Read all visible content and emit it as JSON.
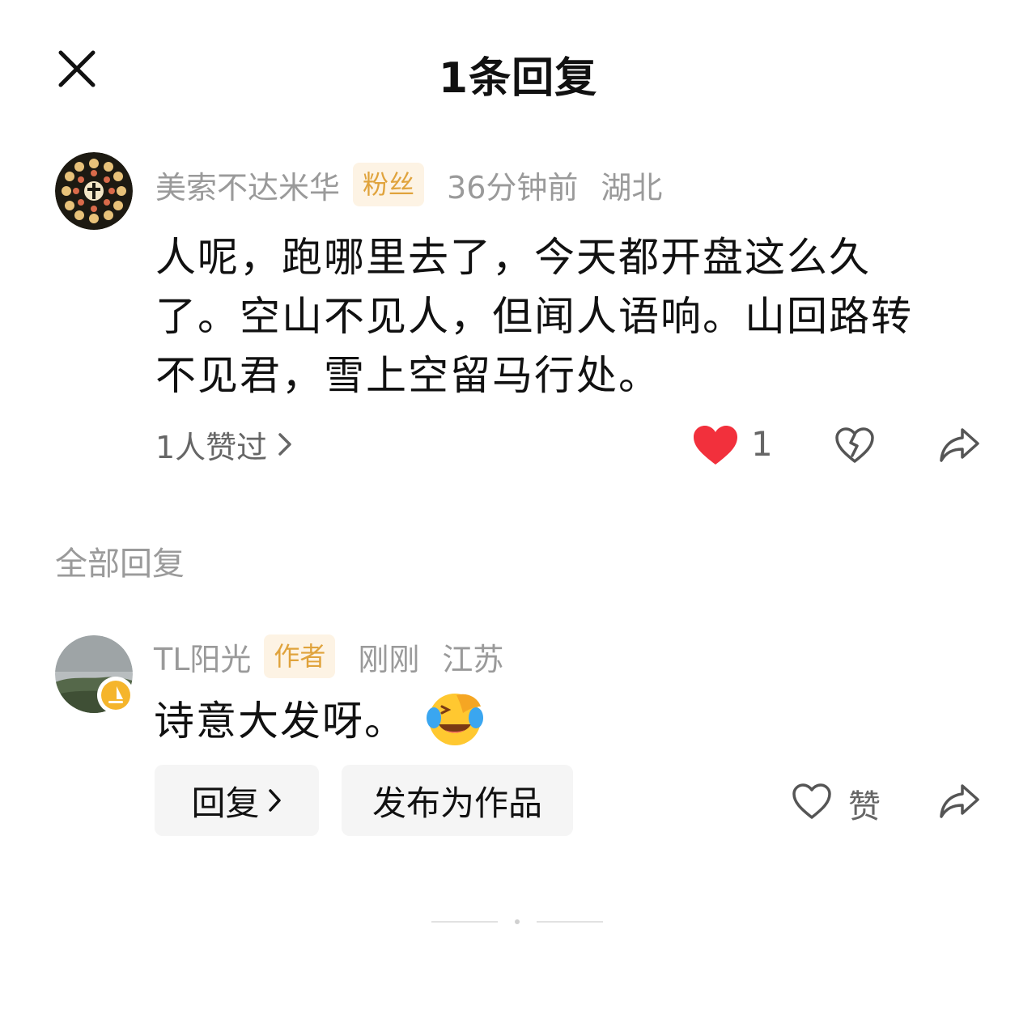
{
  "header": {
    "title": "1条回复",
    "close_icon": "close-icon"
  },
  "comment": {
    "username": "美索不达米华",
    "badge": "粉丝",
    "time": "36分钟前",
    "location": "湖北",
    "text_lines": [
      "人呢，跑哪里去了，今天都开盘这么久",
      "了。空山不见人，但闻人语响。山回路转",
      "不见君，雪上空留马行处。"
    ],
    "likers_label": "1人赞过",
    "like_count": "1",
    "liked": true,
    "colors": {
      "like_red": "#f2303c"
    }
  },
  "section": {
    "all_replies_label": "全部回复"
  },
  "reply": {
    "username": "TL阳光",
    "badge": "作者",
    "time": "刚刚",
    "location": "江苏",
    "text": "诗意大发呀。",
    "emoji": "laughing-crying-emoji",
    "reply_button": "回复",
    "publish_button": "发布为作品",
    "like_label": "赞"
  },
  "colors": {
    "badge_bg": "#fdf3e4",
    "badge_text": "#e0a33c",
    "meta_gray": "#9a9a9a"
  }
}
